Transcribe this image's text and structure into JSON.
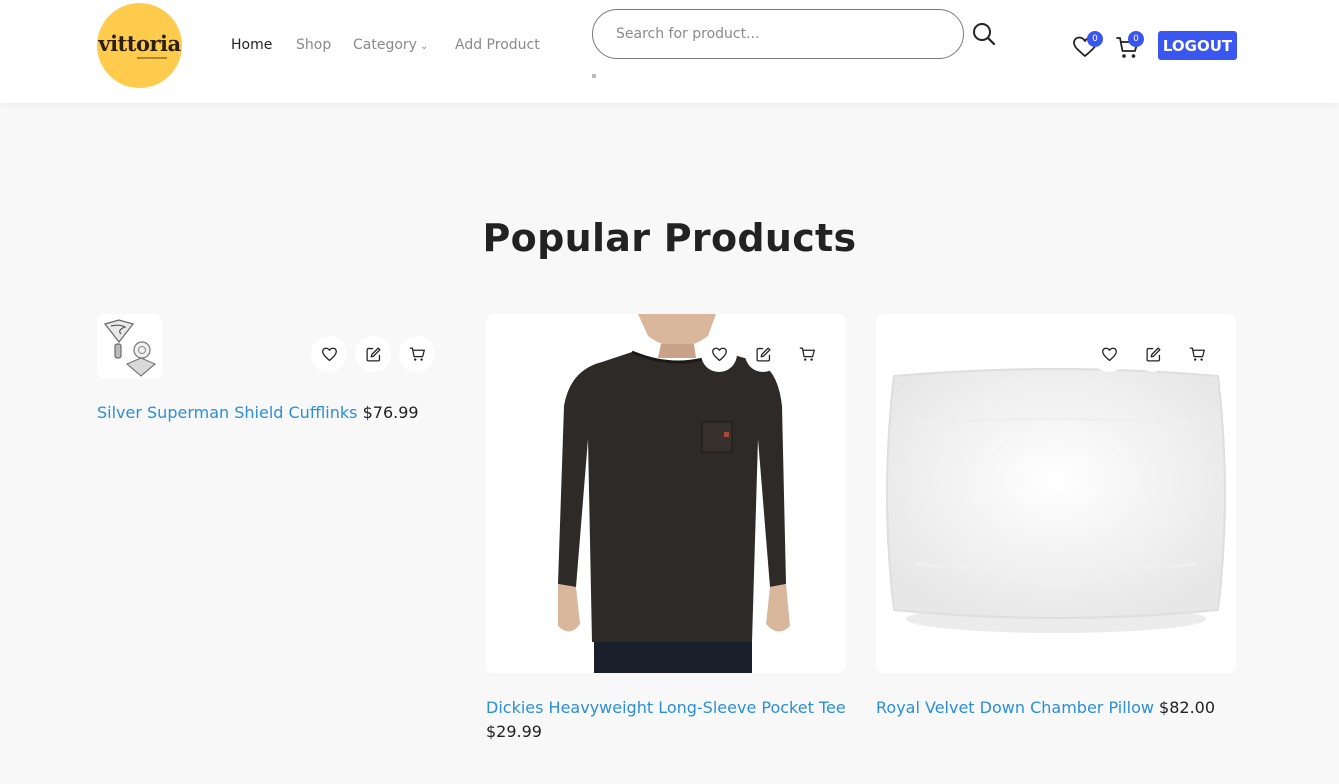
{
  "brand": {
    "logo_text": "vittoria"
  },
  "nav": {
    "home": "Home",
    "shop": "Shop",
    "category": "Category",
    "add_product": "Add Product"
  },
  "search": {
    "placeholder": "Search for product..."
  },
  "header": {
    "wishlist_count": "0",
    "cart_count": "0",
    "logout_label": "LOGOUT"
  },
  "section": {
    "title": "Popular Products"
  },
  "products": [
    {
      "title": "Silver Superman Shield Cufflinks",
      "price": "$76.99",
      "image": "cufflinks-image"
    },
    {
      "title": "Dickies Heavyweight Long-Sleeve Pocket Tee",
      "price": "$29.99",
      "image": "long-sleeve-shirt-image"
    },
    {
      "title": "Royal Velvet Down Chamber Pillow",
      "price": "$82.00",
      "image": "pillow-image"
    }
  ],
  "colors": {
    "accent": "#3a56f0",
    "logo_bg": "#fecb4c",
    "link": "#2a8fd8",
    "page_bg": "#f8f8f8"
  }
}
